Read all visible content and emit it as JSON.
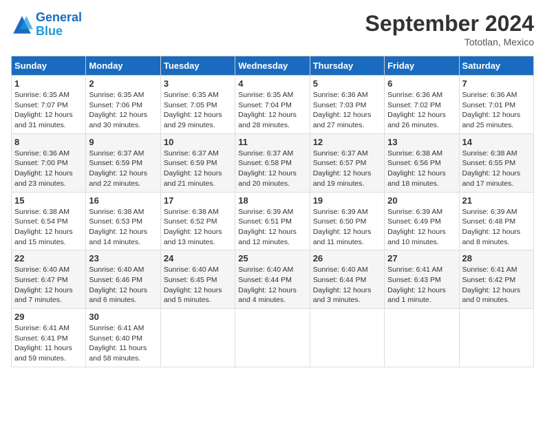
{
  "header": {
    "logo_line1": "General",
    "logo_line2": "Blue",
    "month_title": "September 2024",
    "location": "Tototlan, Mexico"
  },
  "days_of_week": [
    "Sunday",
    "Monday",
    "Tuesday",
    "Wednesday",
    "Thursday",
    "Friday",
    "Saturday"
  ],
  "weeks": [
    [
      {
        "day": "1",
        "sunrise": "6:35 AM",
        "sunset": "7:07 PM",
        "daylight": "12 hours and 31 minutes."
      },
      {
        "day": "2",
        "sunrise": "6:35 AM",
        "sunset": "7:06 PM",
        "daylight": "12 hours and 30 minutes."
      },
      {
        "day": "3",
        "sunrise": "6:35 AM",
        "sunset": "7:05 PM",
        "daylight": "12 hours and 29 minutes."
      },
      {
        "day": "4",
        "sunrise": "6:35 AM",
        "sunset": "7:04 PM",
        "daylight": "12 hours and 28 minutes."
      },
      {
        "day": "5",
        "sunrise": "6:36 AM",
        "sunset": "7:03 PM",
        "daylight": "12 hours and 27 minutes."
      },
      {
        "day": "6",
        "sunrise": "6:36 AM",
        "sunset": "7:02 PM",
        "daylight": "12 hours and 26 minutes."
      },
      {
        "day": "7",
        "sunrise": "6:36 AM",
        "sunset": "7:01 PM",
        "daylight": "12 hours and 25 minutes."
      }
    ],
    [
      {
        "day": "8",
        "sunrise": "6:36 AM",
        "sunset": "7:00 PM",
        "daylight": "12 hours and 23 minutes."
      },
      {
        "day": "9",
        "sunrise": "6:37 AM",
        "sunset": "6:59 PM",
        "daylight": "12 hours and 22 minutes."
      },
      {
        "day": "10",
        "sunrise": "6:37 AM",
        "sunset": "6:59 PM",
        "daylight": "12 hours and 21 minutes."
      },
      {
        "day": "11",
        "sunrise": "6:37 AM",
        "sunset": "6:58 PM",
        "daylight": "12 hours and 20 minutes."
      },
      {
        "day": "12",
        "sunrise": "6:37 AM",
        "sunset": "6:57 PM",
        "daylight": "12 hours and 19 minutes."
      },
      {
        "day": "13",
        "sunrise": "6:38 AM",
        "sunset": "6:56 PM",
        "daylight": "12 hours and 18 minutes."
      },
      {
        "day": "14",
        "sunrise": "6:38 AM",
        "sunset": "6:55 PM",
        "daylight": "12 hours and 17 minutes."
      }
    ],
    [
      {
        "day": "15",
        "sunrise": "6:38 AM",
        "sunset": "6:54 PM",
        "daylight": "12 hours and 15 minutes."
      },
      {
        "day": "16",
        "sunrise": "6:38 AM",
        "sunset": "6:53 PM",
        "daylight": "12 hours and 14 minutes."
      },
      {
        "day": "17",
        "sunrise": "6:38 AM",
        "sunset": "6:52 PM",
        "daylight": "12 hours and 13 minutes."
      },
      {
        "day": "18",
        "sunrise": "6:39 AM",
        "sunset": "6:51 PM",
        "daylight": "12 hours and 12 minutes."
      },
      {
        "day": "19",
        "sunrise": "6:39 AM",
        "sunset": "6:50 PM",
        "daylight": "12 hours and 11 minutes."
      },
      {
        "day": "20",
        "sunrise": "6:39 AM",
        "sunset": "6:49 PM",
        "daylight": "12 hours and 10 minutes."
      },
      {
        "day": "21",
        "sunrise": "6:39 AM",
        "sunset": "6:48 PM",
        "daylight": "12 hours and 8 minutes."
      }
    ],
    [
      {
        "day": "22",
        "sunrise": "6:40 AM",
        "sunset": "6:47 PM",
        "daylight": "12 hours and 7 minutes."
      },
      {
        "day": "23",
        "sunrise": "6:40 AM",
        "sunset": "6:46 PM",
        "daylight": "12 hours and 6 minutes."
      },
      {
        "day": "24",
        "sunrise": "6:40 AM",
        "sunset": "6:45 PM",
        "daylight": "12 hours and 5 minutes."
      },
      {
        "day": "25",
        "sunrise": "6:40 AM",
        "sunset": "6:44 PM",
        "daylight": "12 hours and 4 minutes."
      },
      {
        "day": "26",
        "sunrise": "6:40 AM",
        "sunset": "6:44 PM",
        "daylight": "12 hours and 3 minutes."
      },
      {
        "day": "27",
        "sunrise": "6:41 AM",
        "sunset": "6:43 PM",
        "daylight": "12 hours and 1 minute."
      },
      {
        "day": "28",
        "sunrise": "6:41 AM",
        "sunset": "6:42 PM",
        "daylight": "12 hours and 0 minutes."
      }
    ],
    [
      {
        "day": "29",
        "sunrise": "6:41 AM",
        "sunset": "6:41 PM",
        "daylight": "11 hours and 59 minutes."
      },
      {
        "day": "30",
        "sunrise": "6:41 AM",
        "sunset": "6:40 PM",
        "daylight": "11 hours and 58 minutes."
      },
      null,
      null,
      null,
      null,
      null
    ]
  ]
}
